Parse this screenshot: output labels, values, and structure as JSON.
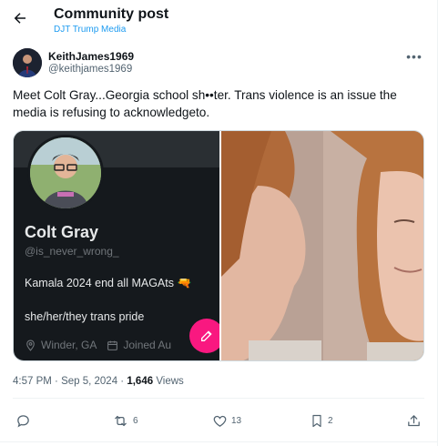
{
  "header": {
    "title": "Community post",
    "subtitle": "DJT Trump Media"
  },
  "post": {
    "author_name": "KeithJames1969",
    "author_handle": "@keithjames1969",
    "text": "Meet Colt Gray...Georgia school sh••ter. Trans violence is an issue the media is refusing to acknowledgeto.",
    "time": "4:57 PM",
    "date": "Sep 5, 2024",
    "views_count": "1,646",
    "views_label": "Views"
  },
  "media": {
    "profile_name": "Colt Gray",
    "profile_handle": "@is_never_wrong_",
    "bio_line1": "Kamala 2024 end all MAGAts 🔫",
    "bio_line2": "she/her/they trans pride",
    "location": "Winder, GA",
    "joined": "Joined Au"
  },
  "actions": {
    "replies": "",
    "reposts": "6",
    "likes": "13",
    "bookmarks": "2"
  },
  "colors": {
    "accent": "#1d9bf0",
    "fab": "#f91880",
    "text_primary": "#0f1419",
    "text_secondary": "#536471"
  }
}
